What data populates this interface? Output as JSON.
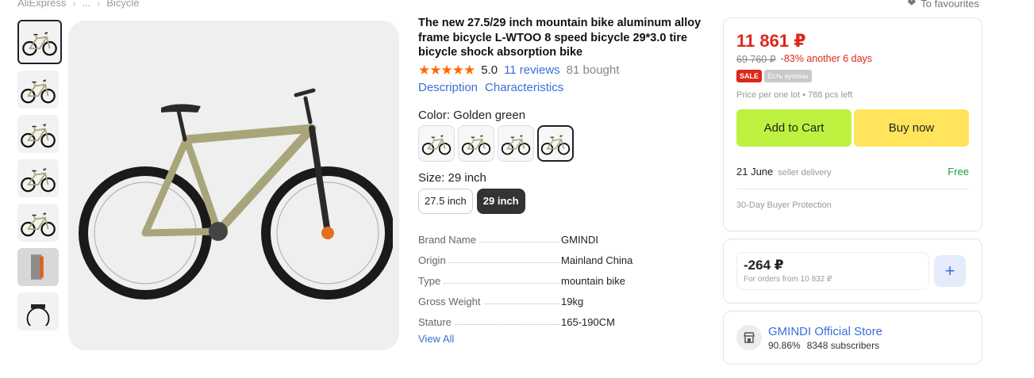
{
  "breadcrumb": [
    "AliExpress",
    "...",
    "Bicycle"
  ],
  "favourites_label": "To favourites",
  "product": {
    "title": "The new 27.5/29 inch mountain bike aluminum alloy frame bicycle L-WTOO 8 speed bicycle 29*3.0 tire bicycle shock absorption bike",
    "stars": "★★★★★",
    "rating": "5.0",
    "reviews": "11 reviews",
    "bought": "81 bought",
    "tab_description": "Description",
    "tab_characteristics": "Characteristics",
    "color_label": "Color: Golden green",
    "size_label": "Size: 29 inch",
    "sizes": [
      "27.5 inch",
      "29 inch"
    ],
    "specs": [
      {
        "key": "Brand Name",
        "value": "GMINDI"
      },
      {
        "key": "Origin",
        "value": "Mainland China"
      },
      {
        "key": "Type",
        "value": "mountain bike"
      },
      {
        "key": "Gross Weight",
        "value": "19kg"
      },
      {
        "key": "Stature",
        "value": "165-190CM"
      }
    ],
    "view_all": "View All"
  },
  "purchase": {
    "price": "11 861 ₽",
    "old_price": "69 760 ₽",
    "discount": "-83% another 6 days",
    "badge_sale": "SALE",
    "badge_coupons": "Есть купоны",
    "per_lot": "Price per one lot • 788 pcs left",
    "add_to_cart": "Add to Cart",
    "buy_now": "Buy now",
    "delivery_date": "21 June",
    "delivery_by": "seller delivery",
    "delivery_cost": "Free",
    "protection": "30-Day Buyer Protection"
  },
  "coupon": {
    "amount": "-264 ₽",
    "condition": "For orders from 10 832 ₽"
  },
  "store": {
    "name": "GMINDI Official Store",
    "rating": "90.86%",
    "subscribers": "8348 subscribers"
  },
  "colors": {
    "price_red": "#e0261b",
    "link_blue": "#3a6fd8",
    "cart_green": "#bff240",
    "buy_yellow": "#ffe45c",
    "frame": "#a9a57a"
  }
}
